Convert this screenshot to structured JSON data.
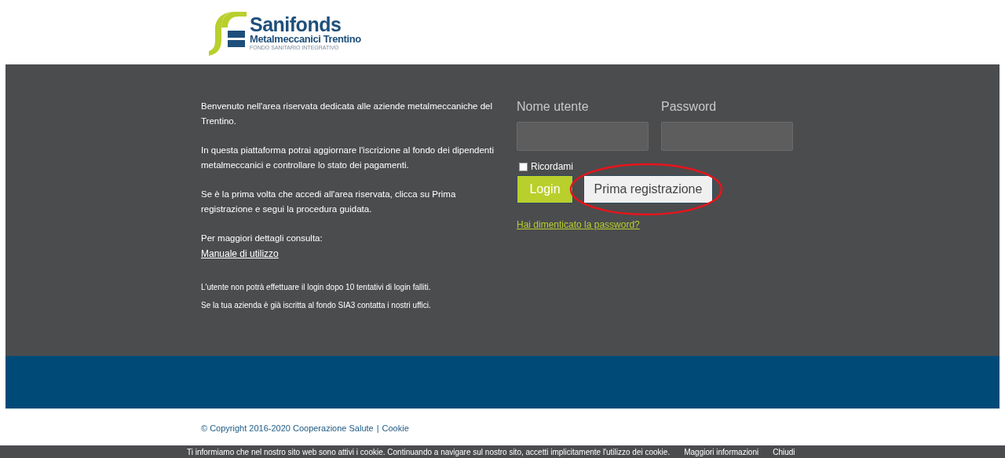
{
  "logo": {
    "name": "Sanifonds",
    "subtitle": "Metalmeccanici Trentino",
    "tagline": "FONDO SANITARIO INTEGRATIVO"
  },
  "intro": {
    "paragraphs": [
      "Benvenuto nell'area riservata dedicata alle aziende metalmeccaniche del Trentino.",
      "In questa piattaforma potrai aggiornare l'iscrizione al fondo dei dipendenti metalmeccanici e controllare lo stato dei pagamenti.",
      "Se è la prima volta che accedi all'area riservata, clicca su Prima registrazione e segui la procedura guidata."
    ],
    "details_label": "Per maggiori dettagli consulta:",
    "manual_link": "Manuale di utilizzo",
    "notes": [
      "L'utente non potrà effettuare il login dopo 10 tentativi di login falliti.",
      "Se la tua azienda è già iscritta al fondo SIA3 contatta i nostri uffici."
    ]
  },
  "login_form": {
    "fields": [
      {
        "label": "Nome utente"
      },
      {
        "label": "Password"
      }
    ],
    "remember": {
      "label": "Ricordami",
      "checked": false
    },
    "login_button": "Login",
    "register_button": "Prima registrazione",
    "forgot_link": "Hai dimenticato la password?"
  },
  "footer": {
    "copyright": "© Copyright 2016-2020 Cooperazione Salute",
    "separator": "|",
    "cookie_link": "Cookie"
  },
  "cookie_bar": {
    "text": "Ti informiamo che nel nostro sito web sono attivi i cookie. Continuando a navigare sul nostro sito, accetti implicitamente l'utilizzo dei cookie.",
    "more_link": "Maggiori informazioni",
    "close_link": "Chiudi"
  }
}
